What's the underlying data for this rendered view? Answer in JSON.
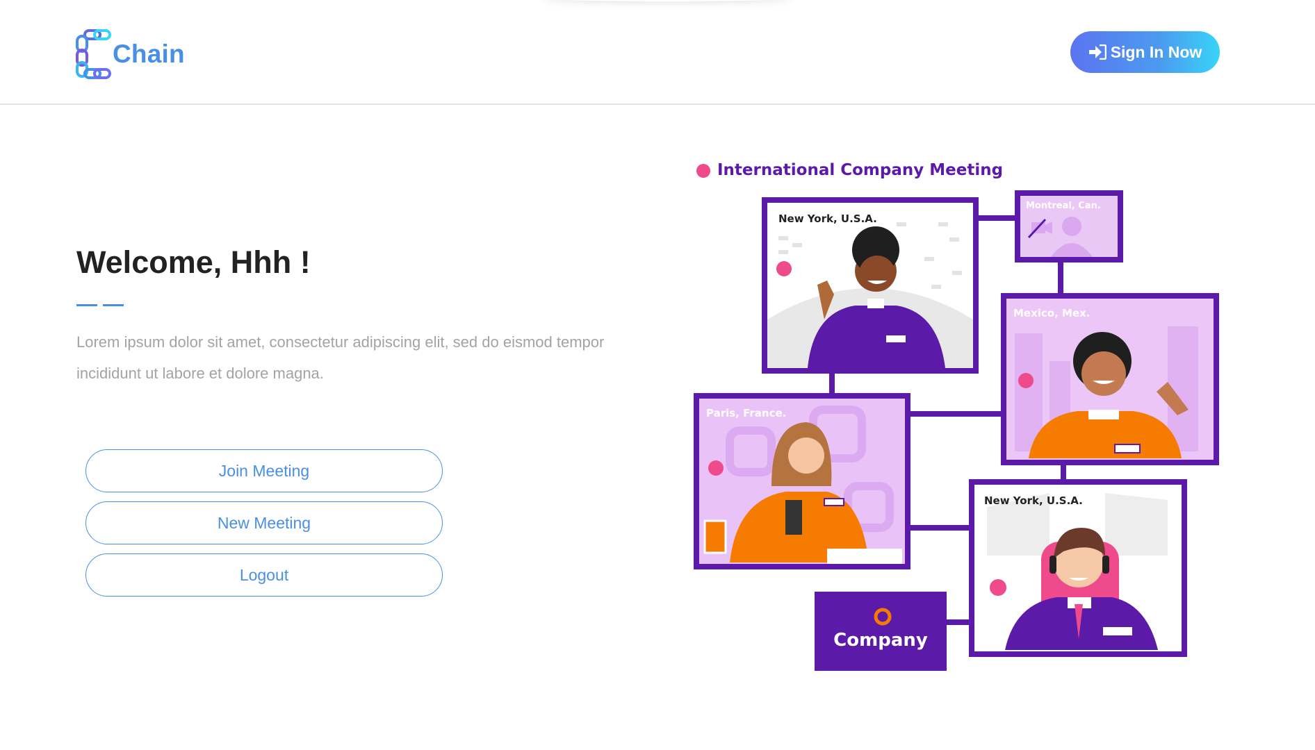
{
  "app": {
    "logo_text": "Chain"
  },
  "header": {
    "signin_label": "Sign In Now"
  },
  "main": {
    "title": "Welcome, Hhh !",
    "description_line1": "Lorem ipsum dolor sit amet, consectetur adipiscing elit, sed do eismod tempor",
    "description_line2": "incididunt ut labore et dolore magna.",
    "buttons": [
      {
        "label": "Join Meeting"
      },
      {
        "label": "New Meeting"
      },
      {
        "label": "Logout"
      }
    ]
  },
  "illustration": {
    "heading": "International Company Meeting",
    "frames": [
      {
        "location": "New York, U.S.A."
      },
      {
        "location": "Montreal, Can."
      },
      {
        "location": "Mexico, Mex."
      },
      {
        "location": "Paris, France."
      },
      {
        "location": "New York, U.S.A."
      }
    ],
    "company_label": "Company"
  },
  "colors": {
    "accent": "#4a8fe6",
    "purple": "#5c1aa8",
    "pink": "#ef4a8b",
    "orange": "#f57c00"
  },
  "icons": [
    "chain-logo-icon",
    "sign-in-icon",
    "video-off-icon"
  ]
}
